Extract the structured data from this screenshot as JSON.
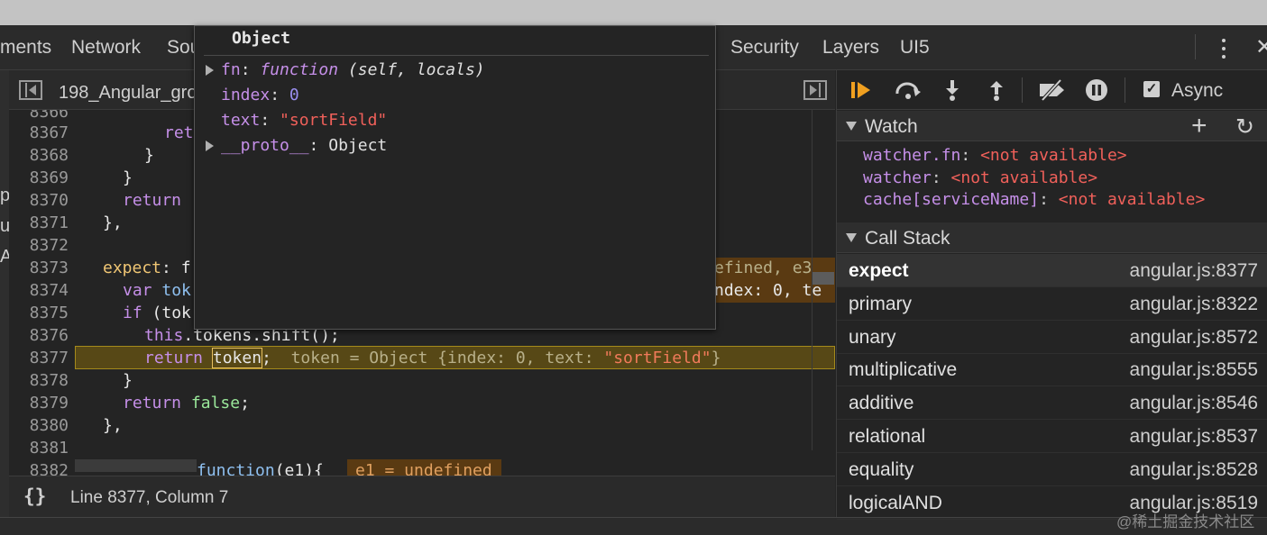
{
  "tabs": {
    "elements": "ments",
    "network": "Network",
    "sources": "Sou",
    "security": "Security",
    "layers": "Layers",
    "ui5": "UI5"
  },
  "file": {
    "name": "198_Angular_gro"
  },
  "left_strip": [
    "p",
    "ul",
    "A"
  ],
  "code": {
    "line_numbers": [
      "8366",
      "8367",
      "8368",
      "8369",
      "8370",
      "8371",
      "8372",
      "8373",
      "8374",
      "8375",
      "8376",
      "8377",
      "8378",
      "8379",
      "8380",
      "8381",
      "8382"
    ],
    "l8367": "ret",
    "l8368": "}",
    "l8369": "}",
    "l8370_kw": "return",
    "l8371": "},",
    "l8373_a": "expect",
    "l8373_b": ": f",
    "l8373_inline": "efined, e3",
    "l8374_kw": "var",
    "l8374_b": " tok",
    "l8374_inline": "ndex: 0, te",
    "l8375_kw": "if",
    "l8375_b": " (tok",
    "l8376_a": "this",
    "l8376_b": ".tokens.shift();",
    "l8377_kw": "return",
    "l8377_b": "token",
    "l8377_c": ";",
    "l8377_inline_a": "token = Object {index: 0, text: ",
    "l8377_inline_str": "\"sortField\"",
    "l8377_inline_end": "}",
    "l8378": "}",
    "l8379_kw": "return",
    "l8379_b": "false",
    "l8379_c": ";",
    "l8380": "},",
    "l8382_a": "function",
    "l8382_b": "(e1){",
    "l8382_inline": "e1 = undefined"
  },
  "status": {
    "braces": "{}",
    "line_info": "Line 8377, Column 7"
  },
  "debugger": {
    "async_label": "Async",
    "async_checked": true
  },
  "watch": {
    "title": "Watch",
    "expressions": [
      {
        "name": "watcher.fn",
        "value": "<not available>"
      },
      {
        "name": "watcher",
        "value": "<not available>"
      },
      {
        "name": "cache[serviceName]",
        "value": "<not available>"
      }
    ]
  },
  "call_stack": {
    "title": "Call Stack",
    "frames": [
      {
        "name": "expect",
        "location": "angular.js:8377",
        "selected": true
      },
      {
        "name": "primary",
        "location": "angular.js:8322"
      },
      {
        "name": "unary",
        "location": "angular.js:8572"
      },
      {
        "name": "multiplicative",
        "location": "angular.js:8555"
      },
      {
        "name": "additive",
        "location": "angular.js:8546"
      },
      {
        "name": "relational",
        "location": "angular.js:8537"
      },
      {
        "name": "equality",
        "location": "angular.js:8528"
      },
      {
        "name": "logicalAND",
        "location": "angular.js:8519"
      }
    ]
  },
  "popup": {
    "title": "Object",
    "fn_key": "fn",
    "fn_kw": "function",
    "fn_sig": " (self, locals)",
    "index_key": "index",
    "index_val": "0",
    "text_key": "text",
    "text_val": "\"sortField\"",
    "proto_key": "__proto__",
    "proto_val": "Object"
  },
  "watermark": "@稀土掘金技术社区",
  "colors": {
    "accent_orange": "#f0a020",
    "keyword": "#c58fe8",
    "string": "#f0605a",
    "current_line": "#574816"
  }
}
